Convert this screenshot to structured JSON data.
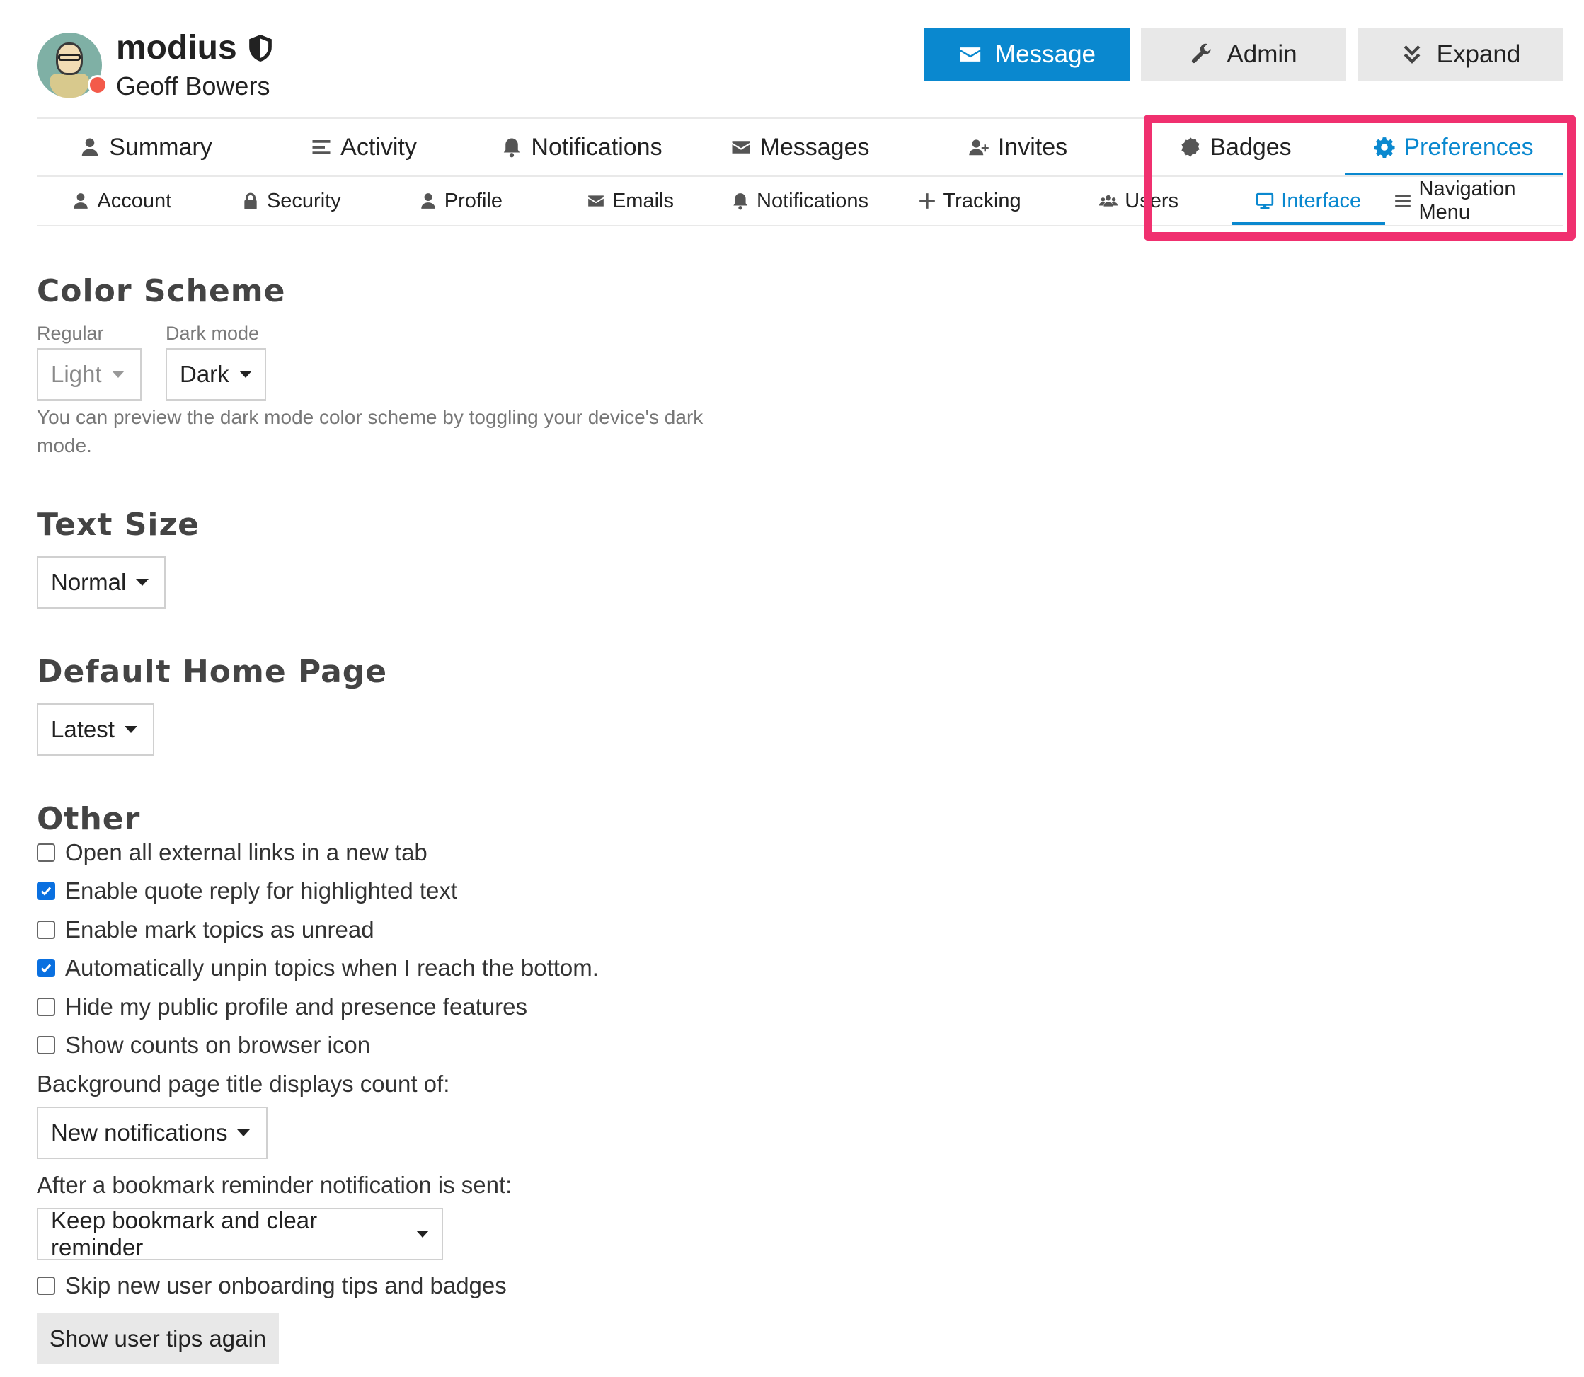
{
  "user": {
    "username": "modius",
    "full_name": "Geoff Bowers"
  },
  "actions": {
    "message": "Message",
    "admin": "Admin",
    "expand": "Expand"
  },
  "main_nav": [
    {
      "label": "Summary",
      "icon": "user-icon"
    },
    {
      "label": "Activity",
      "icon": "list-icon"
    },
    {
      "label": "Notifications",
      "icon": "bell-icon"
    },
    {
      "label": "Messages",
      "icon": "envelope-icon"
    },
    {
      "label": "Invites",
      "icon": "user-plus-icon"
    },
    {
      "label": "Badges",
      "icon": "badge-icon"
    },
    {
      "label": "Preferences",
      "icon": "gear-icon",
      "active": true
    }
  ],
  "sub_nav": [
    {
      "label": "Account",
      "icon": "user-icon"
    },
    {
      "label": "Security",
      "icon": "lock-icon"
    },
    {
      "label": "Profile",
      "icon": "user-icon"
    },
    {
      "label": "Emails",
      "icon": "envelope-icon"
    },
    {
      "label": "Notifications",
      "icon": "bell-icon"
    },
    {
      "label": "Tracking",
      "icon": "plus-icon"
    },
    {
      "label": "Users",
      "icon": "users-icon"
    },
    {
      "label": "Interface",
      "icon": "desktop-icon",
      "active": true
    },
    {
      "label": "Navigation Menu",
      "icon": "bars-icon"
    }
  ],
  "color_scheme": {
    "title": "Color Scheme",
    "regular_label": "Regular",
    "regular_value": "Light",
    "dark_label": "Dark mode",
    "dark_value": "Dark",
    "help": "You can preview the dark mode color scheme by toggling your device's dark mode."
  },
  "text_size": {
    "title": "Text Size",
    "value": "Normal"
  },
  "home_page": {
    "title": "Default Home Page",
    "value": "Latest"
  },
  "other": {
    "title": "Other",
    "checkboxes": [
      {
        "label": "Open all external links in a new tab",
        "checked": false
      },
      {
        "label": "Enable quote reply for highlighted text",
        "checked": true
      },
      {
        "label": "Enable mark topics as unread",
        "checked": false
      },
      {
        "label": "Automatically unpin topics when I reach the bottom.",
        "checked": true
      },
      {
        "label": "Hide my public profile and presence features",
        "checked": false
      },
      {
        "label": "Show counts on browser icon",
        "checked": false
      }
    ],
    "title_count_label": "Background page title displays count of:",
    "title_count_value": "New notifications",
    "bookmark_label": "After a bookmark reminder notification is sent:",
    "bookmark_value": "Keep bookmark and clear reminder",
    "skip_tips": {
      "label": "Skip new user onboarding tips and badges",
      "checked": false
    },
    "show_tips_button": "Show user tips again"
  },
  "colors": {
    "accent": "#0a88cf",
    "highlight": "#f0306f",
    "checkbox_checked": "#0a70e0"
  }
}
